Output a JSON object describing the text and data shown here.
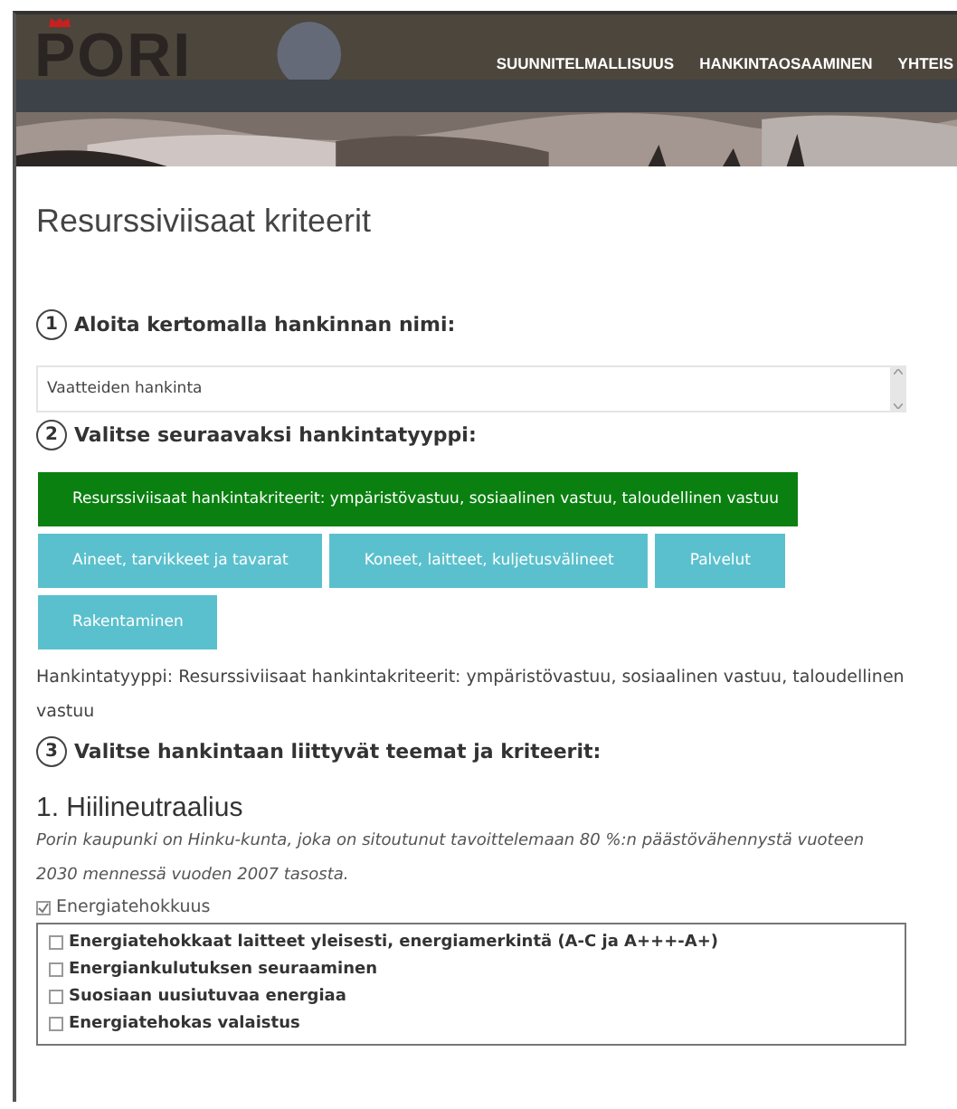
{
  "header": {
    "logo": "PORI",
    "nav": [
      {
        "label": "SUUNNITELMALLISUUS"
      },
      {
        "label": "HANKINTAOSAAMINEN"
      },
      {
        "label": "YHTEIS"
      }
    ]
  },
  "page_title": "Resurssiviisaat kriteerit",
  "step1": {
    "number": "1",
    "label": "Aloita kertomalla hankinnan nimi:",
    "value": "Vaatteiden hankinta"
  },
  "step2": {
    "number": "2",
    "label": "Valitse seuraavaksi hankintatyyppi:",
    "types": [
      {
        "label": "Resurssiviisaat hankintakriteerit: ympäristövastuu, sosiaalinen vastuu, taloudellinen vastuu",
        "selected": true
      },
      {
        "label": "Aineet, tarvikkeet ja tavarat",
        "selected": false
      },
      {
        "label": "Koneet, laitteet, kuljetusvälineet",
        "selected": false
      },
      {
        "label": "Palvelut",
        "selected": false
      },
      {
        "label": "Rakentaminen",
        "selected": false
      }
    ],
    "summary": "Hankintatyyppi: Resurssiviisaat hankintakriteerit: ympäristövastuu, sosiaalinen vastuu, taloudellinen vastuu"
  },
  "step3": {
    "number": "3",
    "label": "Valitse hankintaan liittyvät teemat ja kriteerit:"
  },
  "theme": {
    "title": "1. Hiilineutraalius",
    "description": "Porin kaupunki on Hinku-kunta, joka on sitoutunut tavoittelemaan 80 %:n päästövähennystä vuoteen 2030 mennessä vuoden 2007 tasosta.",
    "category": {
      "label": "Energiatehokkuus",
      "checked": true
    },
    "criteria": [
      {
        "label": "Energiatehokkaat laitteet yleisesti, energiamerkintä (A-C ja A+++-A+)",
        "checked": false
      },
      {
        "label": "Energiankulutuksen seuraaminen",
        "checked": false
      },
      {
        "label": "Suosiaan uusiutuvaa energiaa",
        "checked": false
      },
      {
        "label": "Energiatehokas valaistus",
        "checked": false
      }
    ]
  }
}
